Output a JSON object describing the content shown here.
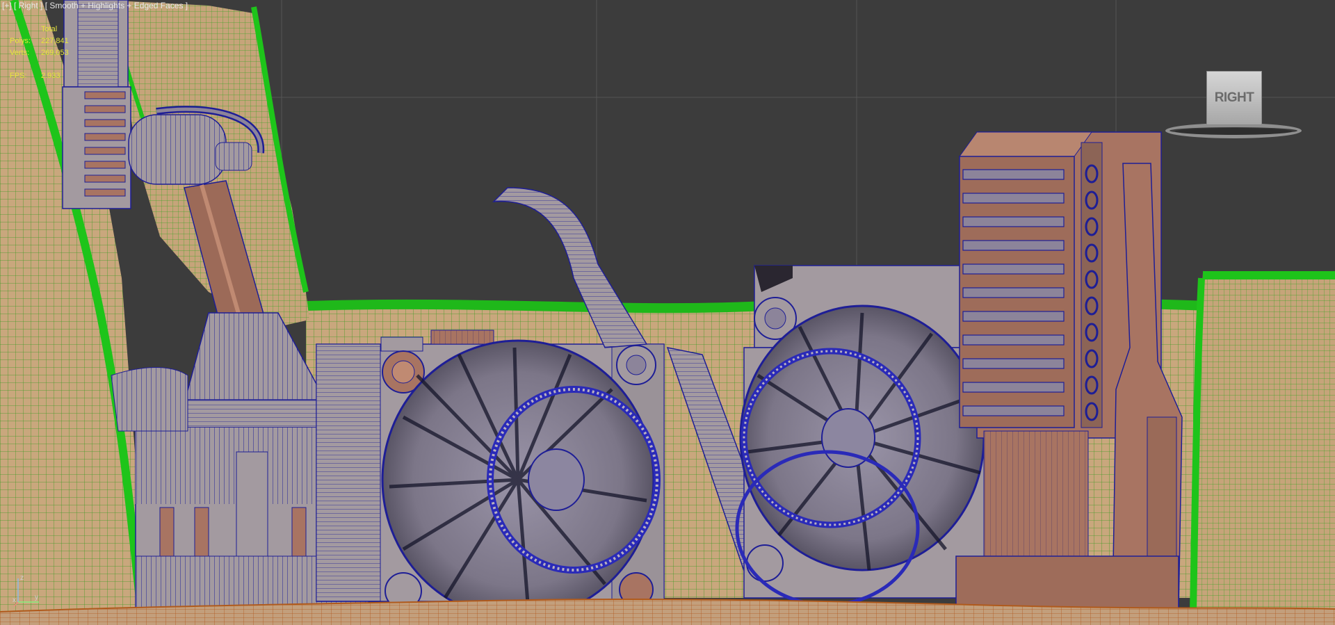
{
  "viewport": {
    "label": "[+] [ Right ] [ Smooth + Highlights + Edged Faces ]"
  },
  "stats": {
    "header": "Total",
    "polys_label": "Polys:",
    "polys_value": "227,841",
    "verts_label": "Verts:",
    "verts_value": "269,053",
    "fps_label": "FPS:",
    "fps_value": "2.933"
  },
  "viewcube": {
    "face_label": "RIGHT"
  },
  "axis": {
    "z": "z",
    "y": "y",
    "x": "x"
  },
  "colors": {
    "background": "#3c3c3c",
    "terrain": "#c7a57b",
    "terrain_wire": "#2aa020",
    "machine_gray": "#a9a0a4",
    "machine_wire": "#1c1ca0",
    "rust": "#a67460",
    "stats_text": "#e6e63c"
  }
}
